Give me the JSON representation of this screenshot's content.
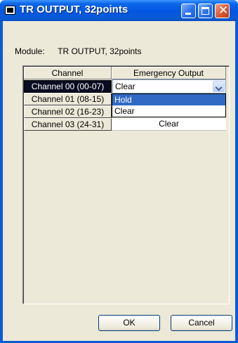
{
  "window": {
    "title": "TR OUTPUT, 32points"
  },
  "module": {
    "label": "Module:",
    "value": "TR OUTPUT, 32points"
  },
  "grid": {
    "columns": [
      "Channel",
      "Emergency Output"
    ],
    "rows": [
      {
        "channel": "Channel 00 (00-07)",
        "output": "Clear",
        "selected": true
      },
      {
        "channel": "Channel 01 (08-15)",
        "output": ""
      },
      {
        "channel": "Channel 02 (16-23)",
        "output": ""
      },
      {
        "channel": "Channel 03 (24-31)",
        "output": "Clear"
      }
    ]
  },
  "dropdown": {
    "options": [
      "Hold",
      "Clear"
    ],
    "highlighted": "Hold"
  },
  "buttons": {
    "ok": "OK",
    "cancel": "Cancel"
  },
  "colors": {
    "titlebar": "#0a5bd6",
    "selection": "#316ac5",
    "dialog_bg": "#ece9d8"
  }
}
